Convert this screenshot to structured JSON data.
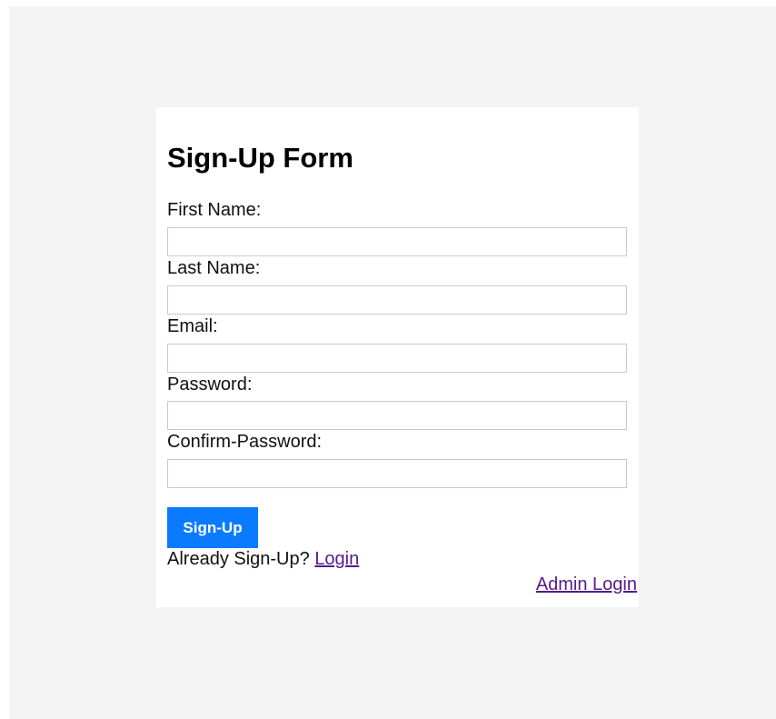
{
  "form": {
    "title": "Sign-Up Form",
    "fields": [
      {
        "label": "First Name:",
        "value": ""
      },
      {
        "label": "Last Name:",
        "value": ""
      },
      {
        "label": "Email:",
        "value": ""
      },
      {
        "label": "Password:",
        "value": ""
      },
      {
        "label": "Confirm-Password:",
        "value": ""
      }
    ],
    "submit_label": "Sign-Up",
    "already_text": "Already Sign-Up?",
    "login_link": "Login",
    "admin_link": "Admin Login"
  },
  "colors": {
    "page_background": "#f3f3f3",
    "card_background": "#ffffff",
    "button_background": "#0a7bff",
    "button_text": "#ffffff",
    "visited_link": "#551a8b"
  }
}
